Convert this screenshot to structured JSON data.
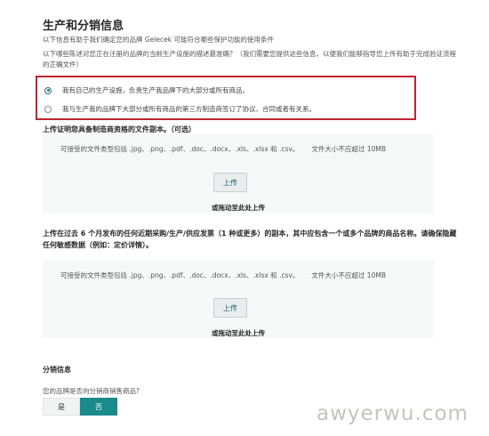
{
  "header": {
    "title": "生产和分销信息",
    "subtitle": "以下信息有助于我们确定您的品牌 Gelecek 可能符合哪些保护功能的使用条件",
    "question": "以下哪些陈述对您正在注册的品牌的当前生产设施的描述最准确？（我们需要您提供这些信息，以便我们能够指导您上传有助于完成验证流程的正确文件）"
  },
  "production_options": [
    {
      "label": "我有自己的生产设施，负责生产我品牌下的大部分或所有商品。",
      "selected": true
    },
    {
      "label": "我与生产我的品牌下大部分或所有商品的第三方制造商签订了协议、合同或者有关系。",
      "selected": false
    }
  ],
  "upload1": {
    "label": "上传证明您具备制造商资格的文件副本。（可选）",
    "hint": "可接受的文件类型包括 .jpg、.png、.pdf、.doc、.docx、.xls、.xlsx 和 .csv。",
    "size_hint": "文件大小不应超过 10MB",
    "button": "上传",
    "drag_text": "或拖动至此处上传"
  },
  "upload2": {
    "label": "上传在过去 6 个月发布的任何近期采购/生产/供应发票（1 种或更多）的副本，其中应包含一个或多个品牌的商品名称。请确保隐藏任何敏感数据（例如：定价详情）。",
    "hint": "可接受的文件类型包括 .jpg、.png、.pdf、.doc、.docx、.xls、.xlsx 和 .csv。",
    "size_hint": "文件大小不应超过 10MB",
    "button": "上传",
    "drag_text": "或拖动至此处上传"
  },
  "distribution": {
    "title": "分销信息",
    "question": "您的品牌是否向分销商销售商品?",
    "yes_label": "是",
    "no_label": "否",
    "selected": "否"
  },
  "watermark": "awyerwu.com",
  "colors": {
    "highlight_border": "#c0242f",
    "accent": "#1a8a8c",
    "radio_checked": "#2a6f7a"
  }
}
